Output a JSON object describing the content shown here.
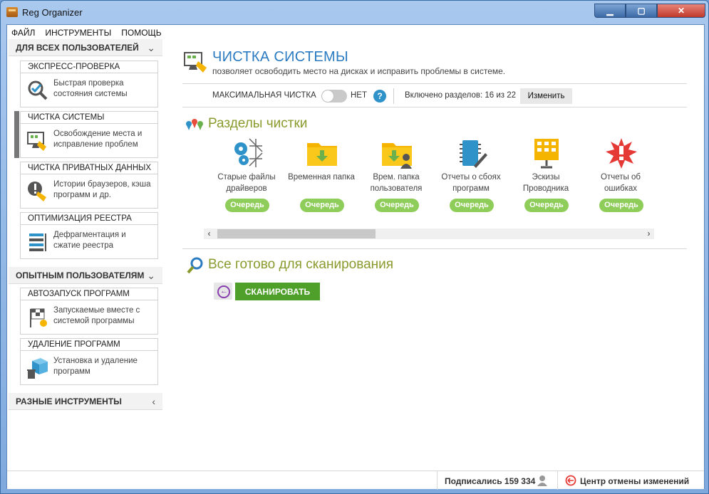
{
  "window": {
    "title": "Reg Organizer",
    "minimize": "▁",
    "maximize": "▢",
    "close": "✕"
  },
  "menu": [
    "ФАЙЛ",
    "ИНСТРУМЕНТЫ",
    "ПОМОЩЬ"
  ],
  "sidebar": {
    "section_all": "ДЛЯ ВСЕХ ПОЛЬЗОВАТЕЛЕЙ",
    "section_advanced": "ОПЫТНЫМ ПОЛЬЗОВАТЕЛЯМ",
    "section_misc": "РАЗНЫЕ ИНСТРУМЕНТЫ",
    "cards": [
      {
        "title": "ЭКСПРЕСС-ПРОВЕРКА",
        "text": "Быстрая проверка состояния системы",
        "icon": "magnifier-check-icon"
      },
      {
        "title": "ЧИСТКА СИСТЕМЫ",
        "text": "Освобождение места и исправление проблем",
        "icon": "monitor-broom-icon",
        "active": true
      },
      {
        "title": "ЧИСТКА ПРИВАТНЫХ ДАННЫХ",
        "text": "Истории браузеров, кэша программ и др.",
        "icon": "privacy-broom-icon"
      },
      {
        "title": "ОПТИМИЗАЦИЯ РЕЕСТРА",
        "text": "Дефрагментация и сжатие реестра",
        "icon": "registry-compress-icon"
      },
      {
        "title": "АВТОЗАПУСК ПРОГРАММ",
        "text": "Запускаемые вместе с системой программы",
        "icon": "startup-flag-icon"
      },
      {
        "title": "УДАЛЕНИЕ ПРОГРАММ",
        "text": "Установка и удаление программ",
        "icon": "box-trash-icon"
      }
    ]
  },
  "main": {
    "title": "ЧИСТКА СИСТЕМЫ",
    "subtitle": "позволяет освободить место на дисках и исправить проблемы в системе.",
    "max_clean_label": "МАКСИМАЛЬНАЯ ЧИСТКА",
    "max_clean_state": "НЕТ",
    "help": "?",
    "enabled_sections": "Включено разделов: 16 из 22",
    "change_button": "Изменить",
    "sections_title": "Разделы чистки",
    "tiles": [
      {
        "label": "Старые файлы драйверов",
        "status": "Очередь",
        "icon": "gears-cobweb-icon"
      },
      {
        "label": "Временная папка",
        "status": "Очередь",
        "icon": "folder-download-icon"
      },
      {
        "label": "Врем. папка пользователя",
        "status": "Очередь",
        "icon": "folder-user-icon"
      },
      {
        "label": "Отчеты о сбоях программ",
        "status": "Очередь",
        "icon": "chip-pen-icon"
      },
      {
        "label": "Эскизы Проводника",
        "status": "Очередь",
        "icon": "thumbnails-folder-icon"
      },
      {
        "label": "Отчеты об ошибках",
        "status": "Очередь",
        "icon": "error-burst-icon"
      }
    ],
    "scroll_left": "‹",
    "scroll_right": "›",
    "ready_title": "Все готово для сканирования",
    "back_arrow": "←",
    "scan_button": "СКАНИРОВАТЬ"
  },
  "status": {
    "subscribers": "Подписались 159 334",
    "undo_center": "Центр отмены изменений"
  },
  "colors": {
    "accent_blue": "#2b7bc2",
    "section_green": "#8a9a2d",
    "queue_green": "#8fcd5a",
    "scan_green": "#4ea02b"
  }
}
